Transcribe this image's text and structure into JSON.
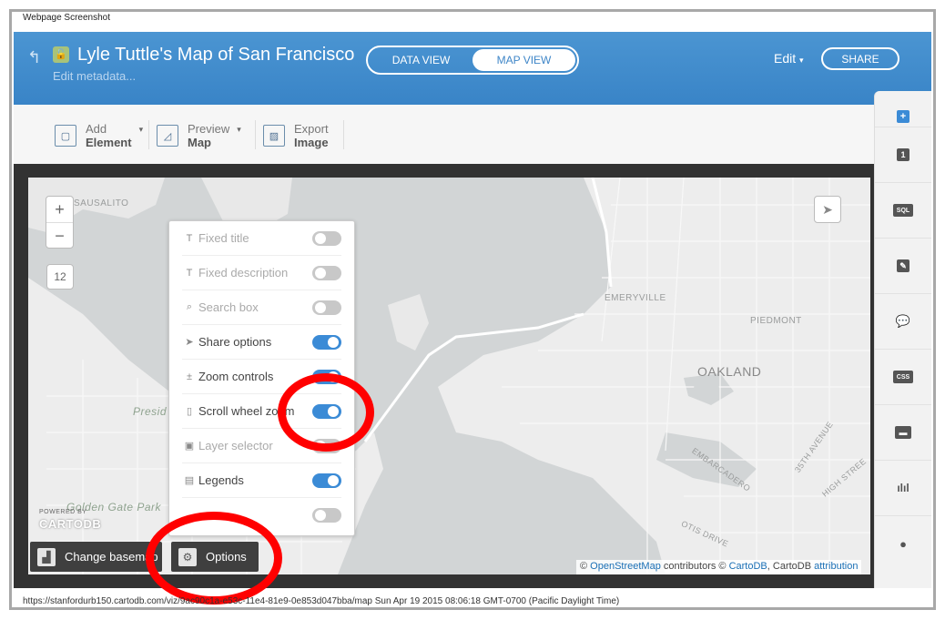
{
  "screenshot": {
    "title": "Webpage Screenshot",
    "footer": "https://stanfordurb150.cartodb.com/viz/9ac90c1a-e53c-11e4-81e9-0e853d047bba/map Sun Apr 19 2015 08:06:18 GMT-0700 (Pacific Daylight Time)"
  },
  "header": {
    "title": "Lyle Tuttle's Map of San Francisco",
    "edit_metadata": "Edit metadata...",
    "tabs": [
      {
        "label": "DATA VIEW",
        "active": false
      },
      {
        "label": "MAP VIEW",
        "active": true
      }
    ],
    "edit_label": "Edit",
    "share_label": "SHARE"
  },
  "toolbar": {
    "items": [
      {
        "line1": "Add",
        "line2": "Element",
        "icon": "add-element-icon",
        "has_caret": true
      },
      {
        "line1": "Preview",
        "line2": "Map",
        "icon": "preview-map-icon",
        "has_caret": true
      },
      {
        "line1": "Export",
        "line2": "Image",
        "icon": "export-image-icon",
        "has_caret": false
      }
    ]
  },
  "map": {
    "zoom_in": "+",
    "zoom_out": "−",
    "zoom_level": "12",
    "labels": {
      "sausalito": "SAUSALITO",
      "emeryville": "EMERYVILLE",
      "piedmont": "PIEDMONT",
      "oakland": "OAKLAND",
      "presidio": "Presid",
      "golden_gate_park": "Golden Gate Park",
      "embarcadero": "EMBARCADERO",
      "ave35": "35TH AVENUE",
      "high_street": "HIGH STREE",
      "otis_drive": "OTIS DRIVE"
    },
    "logo_small": "POWERED BY",
    "logo": "CARTODB",
    "attribution": {
      "prefix": "© ",
      "osm": "OpenStreetMap",
      "middle": " contributors © ",
      "cartodb": "CartoDB",
      "sep": ", CartoDB ",
      "attribution_link": "attribution"
    }
  },
  "options_panel": {
    "items": [
      {
        "label": "Fixed title",
        "icon": "T",
        "on": false
      },
      {
        "label": "Fixed description",
        "icon": "T",
        "on": false
      },
      {
        "label": "Search box",
        "icon": "⌕",
        "on": false
      },
      {
        "label": "Share options",
        "icon": "➤",
        "on": true
      },
      {
        "label": "Zoom controls",
        "icon": "±",
        "on": true
      },
      {
        "label": "Scroll wheel zoom",
        "icon": "▯",
        "on": true
      },
      {
        "label": "Layer selector",
        "icon": "▣",
        "on": false
      },
      {
        "label": "Legends",
        "icon": "▤",
        "on": true
      },
      {
        "label": "",
        "icon": "",
        "on": false
      }
    ]
  },
  "buttons": {
    "change_basemap": "Change basemap",
    "options": "Options"
  },
  "sidebar": {
    "items": [
      {
        "icon": "add-layer-icon",
        "text": "+"
      },
      {
        "icon": "layer-number-icon",
        "text": "1"
      },
      {
        "icon": "sql-icon",
        "text": "SQL"
      },
      {
        "icon": "wizard-brush-icon",
        "text": "✎"
      },
      {
        "icon": "infowindow-icon",
        "text": "💬"
      },
      {
        "icon": "css-icon",
        "text": "CSS"
      },
      {
        "icon": "legend-icon",
        "text": "▬"
      },
      {
        "icon": "filters-icon",
        "text": "ılıl"
      },
      {
        "icon": "add-marker-icon",
        "text": "●"
      }
    ]
  },
  "colors": {
    "header_blue": "#3f8ace",
    "switch_on": "#3b8bd6",
    "highlight_red": "#ff0000"
  }
}
